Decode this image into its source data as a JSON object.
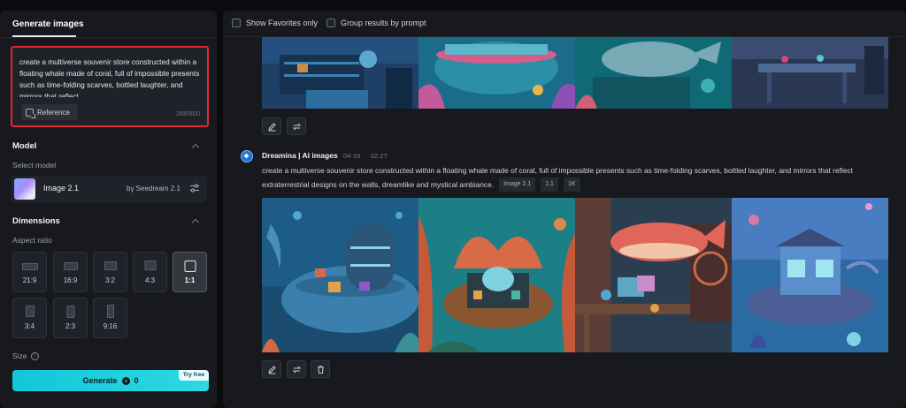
{
  "left_panel": {
    "tab_label": "Generate images",
    "prompt": {
      "text": "create a multiverse souvenir store constructed within a floating whale made of coral, full of impossible presents such as time-folding scarves, bottled laughter, and mirrors that reflect",
      "reference_label": "Reference",
      "counter": "288/800"
    },
    "model_section": {
      "title": "Model",
      "select_label": "Select model",
      "model_name": "Image 2.1",
      "model_by": "by Seedream 2.1"
    },
    "dimensions_section": {
      "title": "Dimensions",
      "aspect_label": "Aspect ratio",
      "ratios": [
        "21:9",
        "16:9",
        "3:2",
        "4:3",
        "1:1",
        "3:4",
        "2:3",
        "9:16"
      ],
      "selected_ratio": "1:1"
    },
    "size_label": "Size",
    "generate": {
      "label": "Generate",
      "cost": "0",
      "badge": "Try free"
    }
  },
  "main": {
    "filters": {
      "favorites_label": "Show Favorites only",
      "group_label": "Group results by prompt"
    },
    "group": {
      "title": "Dreamina | AI images",
      "date": "04-19",
      "time": "02:27",
      "prompt_line1": "create a multiverse souvenir store constructed within a floating whale made of coral, full of impossible presents such as time-folding scarves, bottled laughter, and mirrors that reflect",
      "prompt_line2": "extraterrestrial designs on the walls, dreamlike and mystical ambiance.",
      "tags": [
        "Image 2.1",
        "1:1",
        "1K"
      ]
    }
  },
  "icons": {
    "reference": "image-reference-icon",
    "settings": "sliders-icon",
    "info": "info-icon",
    "coin": "credit-coin-icon",
    "edit": "pencil-icon",
    "reprompt": "reprompt-icon",
    "delete": "trash-icon",
    "logo": "dreamina-logo-icon"
  },
  "colors": {
    "accent": "#13c7d6",
    "highlight_border": "#e4262e",
    "panel_bg": "#17191f"
  }
}
